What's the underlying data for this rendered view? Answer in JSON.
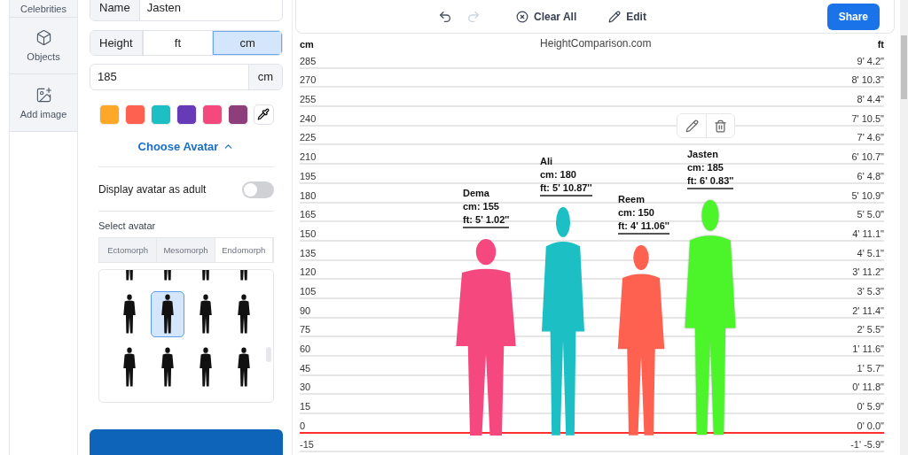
{
  "nav": [
    {
      "label": "Celebrities"
    },
    {
      "label": "Objects"
    },
    {
      "label": "Add image"
    }
  ],
  "form": {
    "name_label": "Name",
    "name_value": "Jasten",
    "height_label": "Height",
    "units": [
      {
        "label": "ft",
        "selected": false
      },
      {
        "label": "cm",
        "selected": true
      }
    ],
    "height_value": "185",
    "height_unit": "cm",
    "swatches": [
      {
        "color": "#ffa726"
      },
      {
        "color": "#ff6150"
      },
      {
        "color": "#1bbfc4"
      },
      {
        "color": "#673ab7"
      },
      {
        "color": "#f5487f"
      },
      {
        "color": "#8e3e7a"
      }
    ],
    "choose_avatar": "Choose Avatar",
    "avatar_expanded": true,
    "adult_label": "Display avatar as adult",
    "adult_on": false,
    "select_label": "Select avatar",
    "body_tabs": [
      {
        "label": "Ectomorph",
        "selected": false
      },
      {
        "label": "Mesomorph",
        "selected": false
      },
      {
        "label": "Endomorph",
        "selected": true
      }
    ],
    "avatars": [
      {
        "selected": false
      },
      {
        "selected": false
      },
      {
        "selected": false
      },
      {
        "selected": false
      },
      {
        "selected": false
      },
      {
        "selected": true
      },
      {
        "selected": false
      },
      {
        "selected": false
      },
      {
        "selected": false
      },
      {
        "selected": false
      },
      {
        "selected": false
      },
      {
        "selected": false
      }
    ]
  },
  "toolbar": {
    "undo_disabled": false,
    "redo_disabled": true,
    "clear_label": "Clear All",
    "edit_label": "Edit",
    "share_label": "Share"
  },
  "ruler": {
    "left_unit": "cm",
    "site": "HeightComparison.com",
    "right_unit": "ft",
    "ticks": [
      {
        "cm": "285",
        "ft": "9' 4.2\"",
        "ground": false
      },
      {
        "cm": "270",
        "ft": "8' 10.3\"",
        "ground": false
      },
      {
        "cm": "255",
        "ft": "8' 4.4\"",
        "ground": false
      },
      {
        "cm": "240",
        "ft": "7' 10.5\"",
        "ground": false
      },
      {
        "cm": "225",
        "ft": "7' 4.6\"",
        "ground": false
      },
      {
        "cm": "210",
        "ft": "6' 10.7\"",
        "ground": false
      },
      {
        "cm": "195",
        "ft": "6' 4.8\"",
        "ground": false
      },
      {
        "cm": "180",
        "ft": "5' 10.9\"",
        "ground": false
      },
      {
        "cm": "165",
        "ft": "5' 5.0\"",
        "ground": false
      },
      {
        "cm": "150",
        "ft": "4' 11.1\"",
        "ground": false
      },
      {
        "cm": "135",
        "ft": "4' 5.1\"",
        "ground": false
      },
      {
        "cm": "120",
        "ft": "3' 11.2\"",
        "ground": false
      },
      {
        "cm": "105",
        "ft": "3' 5.3\"",
        "ground": false
      },
      {
        "cm": "90",
        "ft": "2' 11.4\"",
        "ground": false
      },
      {
        "cm": "75",
        "ft": "2' 5.5\"",
        "ground": false
      },
      {
        "cm": "60",
        "ft": "1' 11.6\"",
        "ground": false
      },
      {
        "cm": "45",
        "ft": "1' 5.7\"",
        "ground": false
      },
      {
        "cm": "30",
        "ft": "0' 11.8\"",
        "ground": false
      },
      {
        "cm": "15",
        "ft": "0' 5.9\"",
        "ground": false
      },
      {
        "cm": "0",
        "ft": "0' 0.0\"",
        "ground": true
      },
      {
        "cm": "-15",
        "ft": "-1' -5.9\"",
        "ground": false
      }
    ]
  },
  "people": [
    {
      "name": "Dema",
      "cm": "cm: 155",
      "ft": "ft: 5' 1.02''",
      "color": "#f5487f",
      "selected": false
    },
    {
      "name": "Ali",
      "cm": "cm: 180",
      "ft": "ft: 5' 10.87''",
      "color": "#1bbfc4",
      "selected": false
    },
    {
      "name": "Reem",
      "cm": "cm: 150",
      "ft": "ft: 4' 11.06''",
      "color": "#ff6150",
      "selected": false
    },
    {
      "name": "Jasten",
      "cm": "cm: 185",
      "ft": "ft: 6' 0.83''",
      "color": "#4cf52a",
      "selected": true
    }
  ]
}
